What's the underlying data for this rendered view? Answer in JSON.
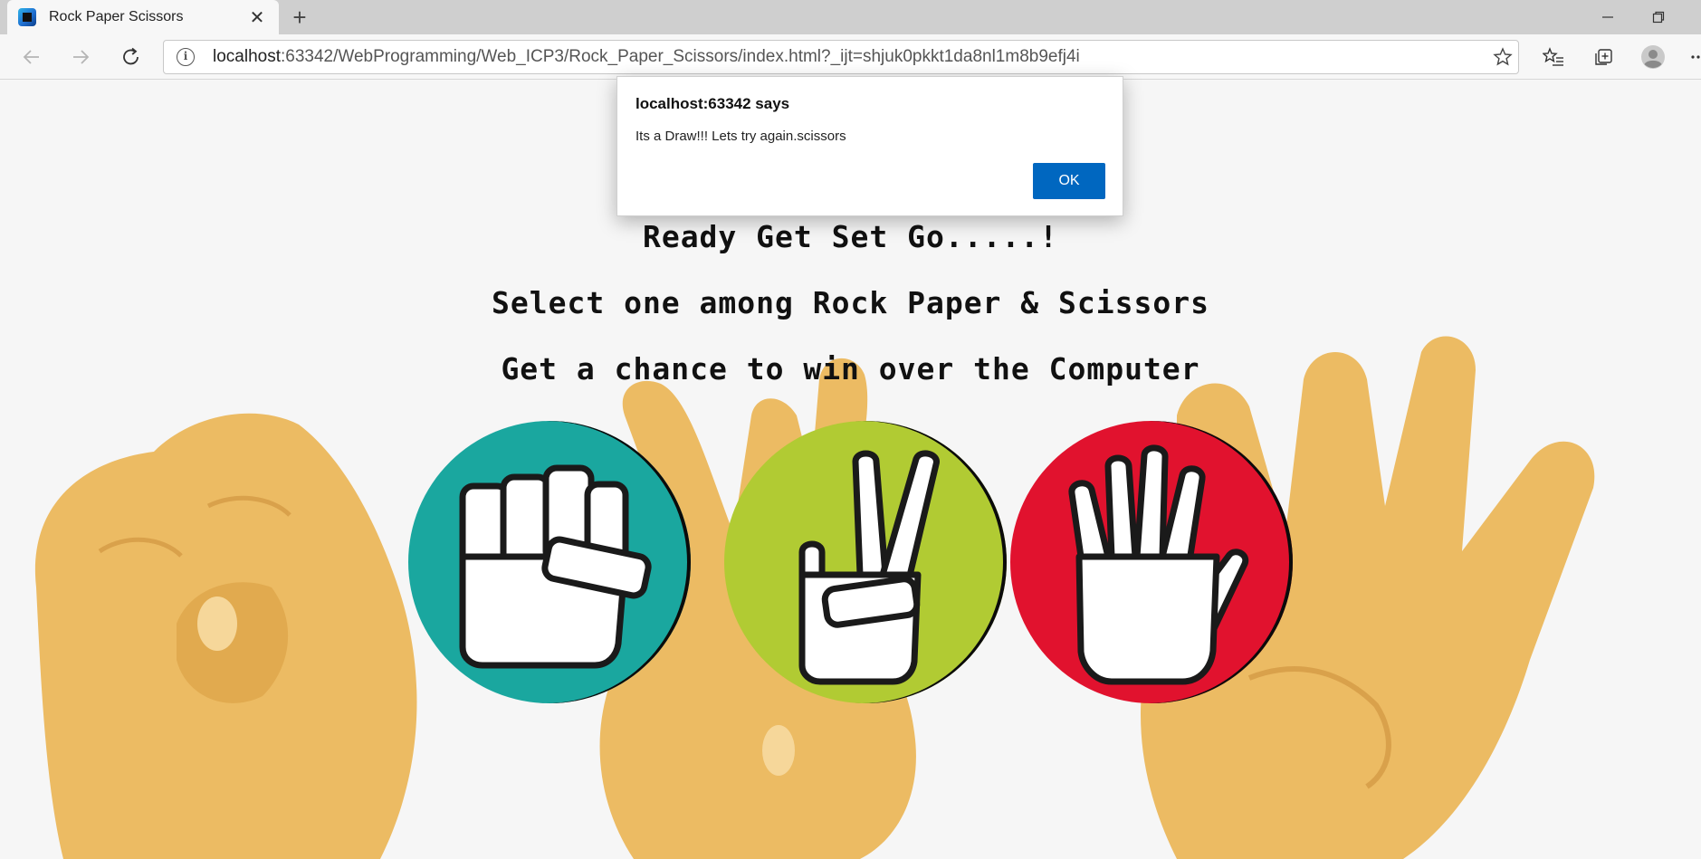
{
  "browser": {
    "tab": {
      "title": "Rock Paper Scissors",
      "favicon": "webstorm-icon"
    },
    "address": {
      "host": "localhost",
      "rest": ":63342/WebProgramming/Web_ICP3/Rock_Paper_Scissors/index.html?_ijt=shjuk0pkkt1da8nl1m8b9efj4i"
    }
  },
  "page": {
    "headline1": "Ready Get Set Go.....!",
    "headline2": "Select one among Rock Paper & Scissors",
    "headline3": "Get a chance to win over the Computer",
    "choices": [
      {
        "id": "rock",
        "color": "#1aa79f",
        "icon": "fist-icon"
      },
      {
        "id": "scissors",
        "color": "#b1cb33",
        "icon": "peace-sign-icon"
      },
      {
        "id": "paper",
        "color": "#e1122e",
        "icon": "open-hand-icon"
      }
    ]
  },
  "dialog": {
    "title": "localhost:63342 says",
    "message": "Its a Draw!!! Lets try again.scissors",
    "ok_label": "OK",
    "accent": "#0067c0"
  }
}
